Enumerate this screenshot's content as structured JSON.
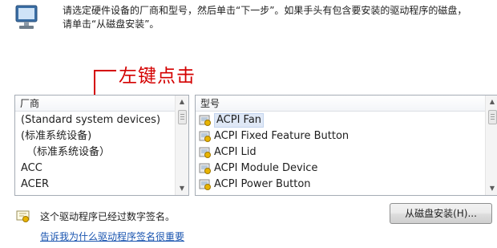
{
  "header": {
    "instruction_line1": "请选定硬件设备的厂商和型号，然后单击“下一步”。如果手头有包含要安装的驱动程序的磁盘，",
    "instruction_line2": "请单击“从磁盘安装”。",
    "icon": "computer-monitor-icon"
  },
  "annotation": {
    "text": "左键点击",
    "color": "#d40000"
  },
  "manufacturer_list": {
    "header": "厂商",
    "items": [
      "(Standard system devices)",
      "(标准系统设备)",
      "（标准系统设备）",
      "ACC",
      "ACER"
    ]
  },
  "model_list": {
    "header": "型号",
    "items": [
      "ACPI Fan",
      "ACPI Fixed Feature Button",
      "ACPI Lid",
      "ACPI Module Device",
      "ACPI Power Button"
    ],
    "selected_index": 0,
    "item_icon": "driver-device-icon"
  },
  "footer": {
    "signature_text": "这个驱动程序已经过数字签名。",
    "signature_icon": "certificate-icon",
    "link_text": "告诉我为什么驱动程序签名很重要",
    "have_disk_button": "从磁盘安装(H)...",
    "link_color": "#1a55b0"
  }
}
